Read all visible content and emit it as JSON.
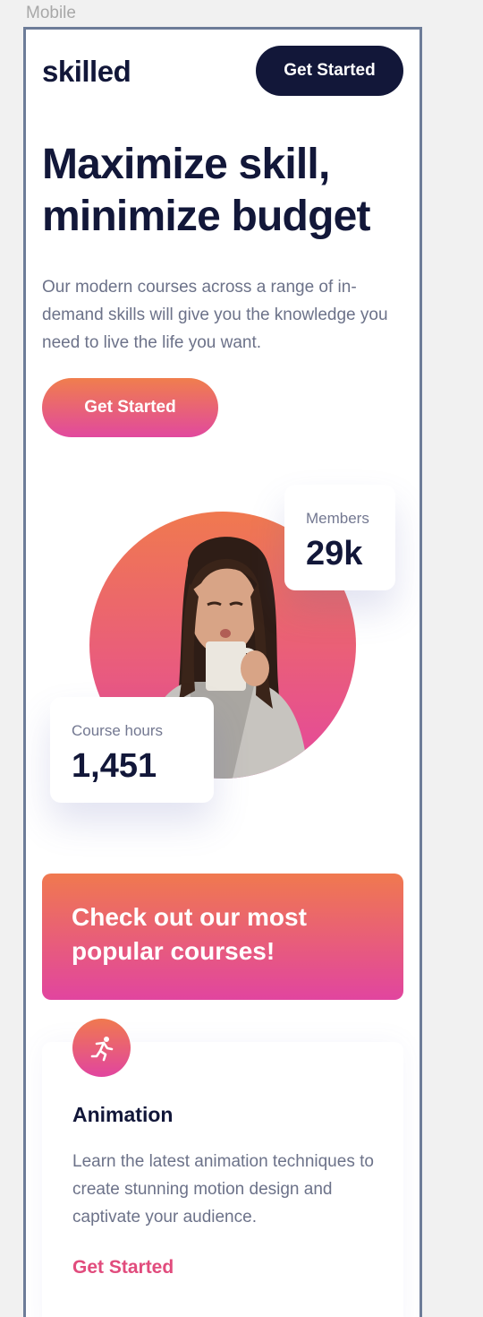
{
  "canvas": {
    "frame_label": "Mobile"
  },
  "header": {
    "logo": "skilled",
    "cta_label": "Get Started"
  },
  "hero": {
    "title": "Maximize skill, minimize budget",
    "description": "Our modern courses across a range of in-demand skills will give you the knowledge you need to live the life you want.",
    "cta_label": "Get Started"
  },
  "stats": {
    "members": {
      "label": "Members",
      "value": "29k"
    },
    "course_hours": {
      "label": "Course hours",
      "value": "1,451"
    }
  },
  "courses": {
    "banner_title": "Check out our most popular courses!",
    "items": [
      {
        "icon": "running-person-icon",
        "name": "Animation",
        "description": "Learn the latest animation techniques to create stunning motion design and captivate your audience.",
        "link_label": "Get Started"
      }
    ]
  },
  "colors": {
    "navy": "#121739",
    "gradient_start": "#f07e4d",
    "gradient_end": "#e1499e",
    "link_pink": "#e14c7d",
    "body_text": "#6c7289"
  }
}
